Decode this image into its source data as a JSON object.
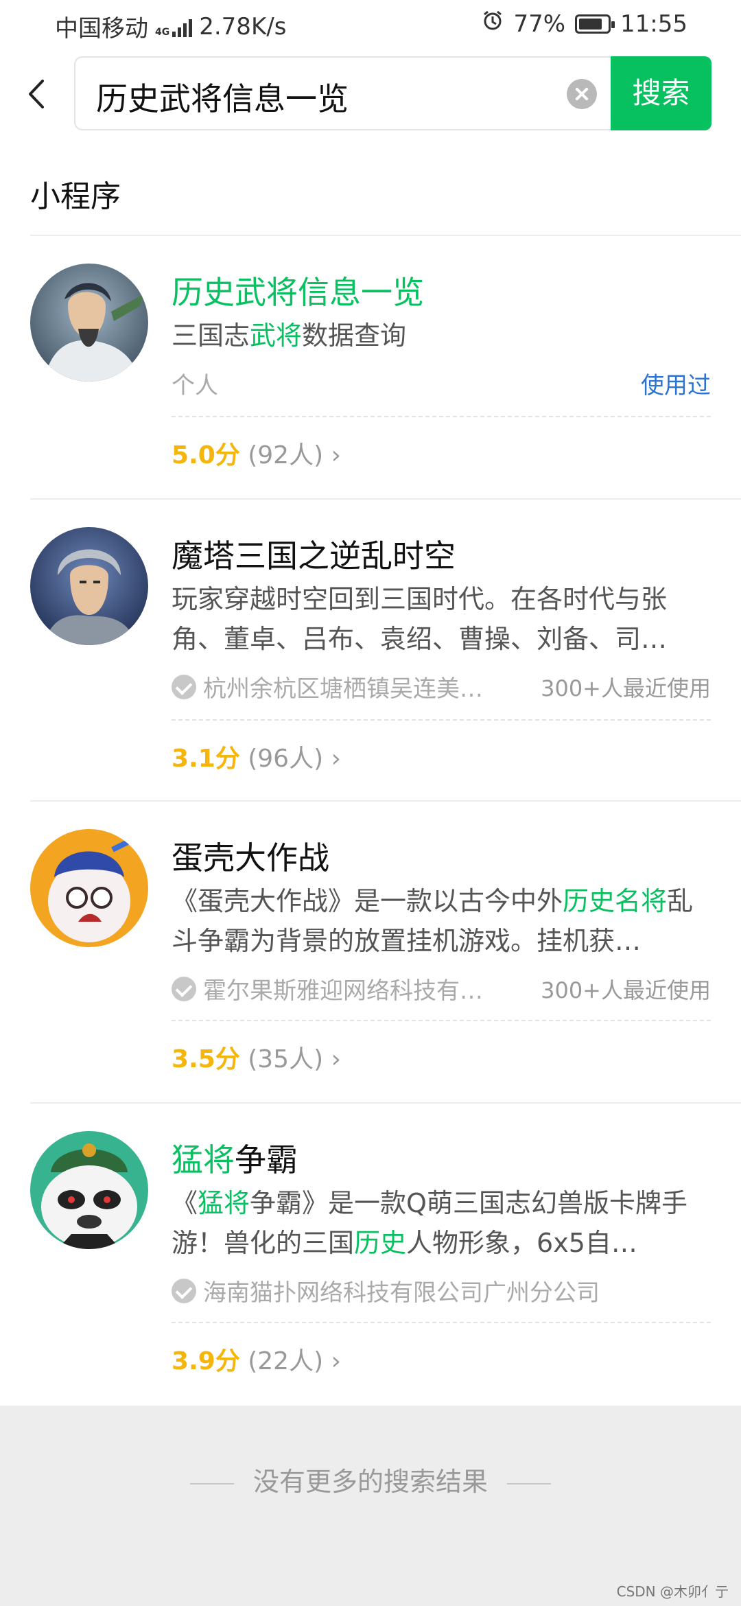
{
  "status": {
    "carrier": "中国移动",
    "net_type": "4G",
    "speed": "2.78K/s",
    "battery": "77%",
    "time": "11:55"
  },
  "search": {
    "query": "历史武将信息一览",
    "button": "搜索"
  },
  "section": {
    "title": "小程序"
  },
  "items": [
    {
      "title_hl": "历史武将信息一览",
      "title_rest": "",
      "desc_a": "三国志",
      "desc_hl": "武将",
      "desc_b": "数据查询",
      "owner": "个人",
      "tag": "使用过",
      "score": "5.0分",
      "count": "(92人)"
    },
    {
      "title": "魔塔三国之逆乱时空",
      "desc": "玩家穿越时空回到三国时代。在各时代与张角、董卓、吕布、袁绍、曹操、刘备、司…",
      "org": "杭州余杭区塘栖镇吴连美…",
      "usage": "300+人最近使用",
      "score": "3.1分",
      "count": "(96人)"
    },
    {
      "title": "蛋壳大作战",
      "desc_a": "《蛋壳大作战》是一款以古今中外",
      "desc_hl": "历史名将",
      "desc_b": "乱斗争霸为背景的放置挂机游戏。挂机获…",
      "org": "霍尔果斯雅迎网络科技有…",
      "usage": "300+人最近使用",
      "score": "3.5分",
      "count": "(35人)"
    },
    {
      "title_hl": "猛将",
      "title_rest": "争霸",
      "desc_a": "《",
      "desc_hl1": "猛将",
      "desc_b": "争霸》是一款Q萌三国志幻兽版卡牌手游！兽化的三国",
      "desc_hl2": "历史",
      "desc_c": "人物形象，6x5自…",
      "org": "海南猫扑网络科技有限公司广州分公司",
      "score": "3.9分",
      "count": "(22人)"
    }
  ],
  "footer": {
    "text": "没有更多的搜索结果"
  },
  "watermark": "CSDN @木卯亻亍"
}
